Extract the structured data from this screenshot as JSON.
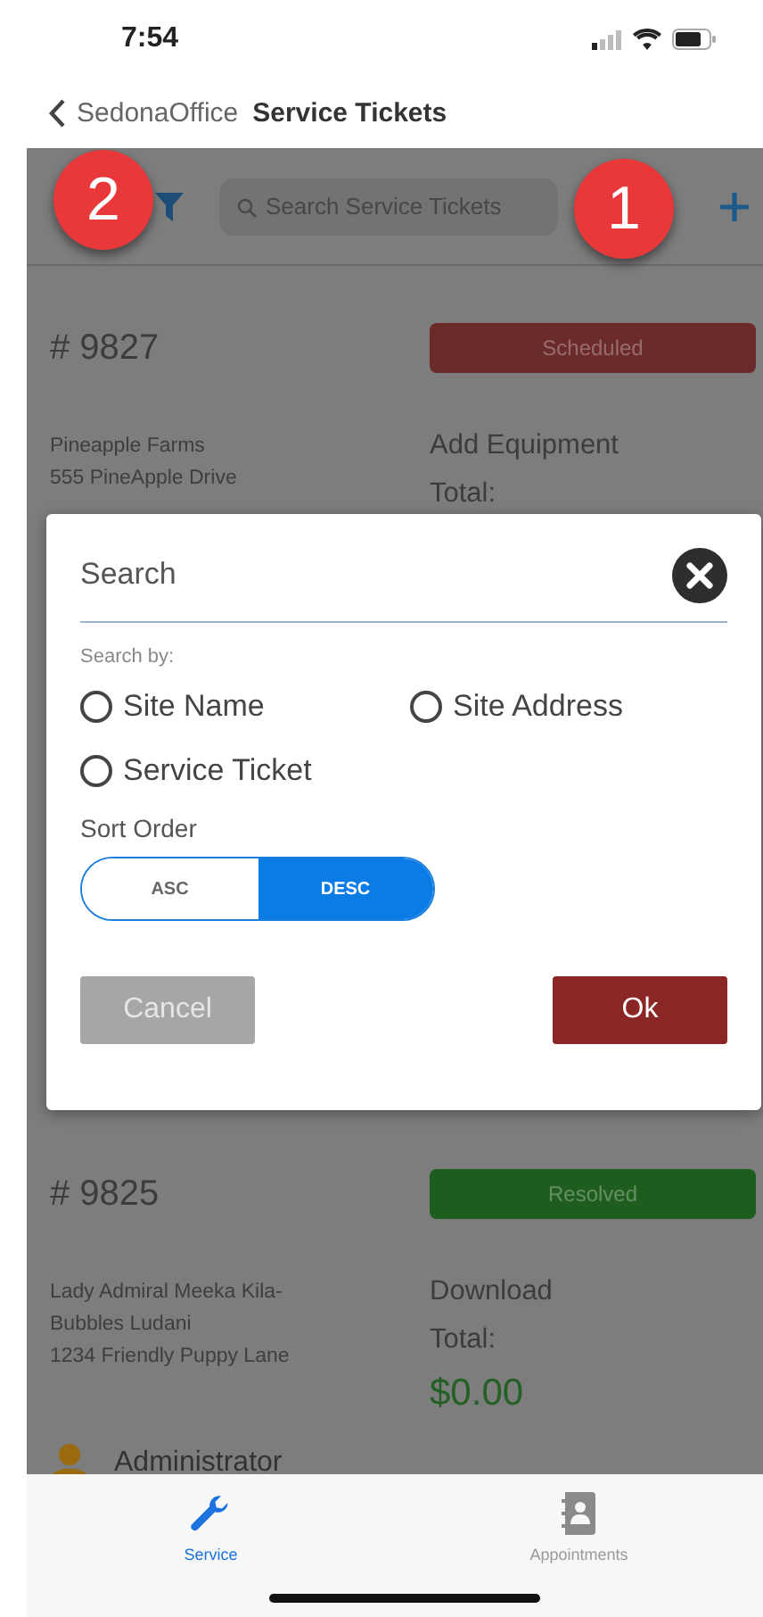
{
  "status_bar": {
    "time": "7:54"
  },
  "nav": {
    "back_label": "SedonaOffice",
    "title": "Service Tickets"
  },
  "toolbar": {
    "search": {
      "placeholder": "Search Service Tickets"
    }
  },
  "callouts": [
    {
      "label": "2"
    },
    {
      "label": "1"
    }
  ],
  "tickets": [
    {
      "number": "# 9827",
      "status": "Scheduled",
      "color": "#6b2b2b",
      "site_lines": [
        "Pineapple Farms",
        "555 PineApple Drive"
      ],
      "action": "Add Equipment",
      "total_label": "Total:"
    },
    {
      "number": "# 9825",
      "status": "Resolved",
      "color": "#1f5d1f",
      "site_lines": [
        "Lady Admiral Meeka Kila-",
        "Bubbles Ludani",
        "1234 Friendly Puppy Lane"
      ],
      "action": "Download",
      "total_label": "Total:",
      "total": "$0.00",
      "assignee": "Administrator"
    }
  ],
  "dialog": {
    "search": {
      "placeholder": "Search"
    },
    "search_by_label": "Search by:",
    "options": [
      {
        "label": "Site Name",
        "checked": false
      },
      {
        "label": "Site Address",
        "checked": false
      },
      {
        "label": "Service Ticket",
        "checked": false
      }
    ],
    "sort_label": "Sort Order",
    "sort": [
      {
        "label": "ASC",
        "selected": false
      },
      {
        "label": "DESC",
        "selected": true
      }
    ],
    "buttons": [
      {
        "label": "Cancel",
        "kind": "secondary"
      },
      {
        "label": "Ok",
        "kind": "primary"
      }
    ]
  },
  "tab_bar": [
    {
      "label": "Service",
      "kind": "service",
      "selected": true
    },
    {
      "label": "Appointments",
      "kind": "appointments",
      "selected": false
    }
  ]
}
